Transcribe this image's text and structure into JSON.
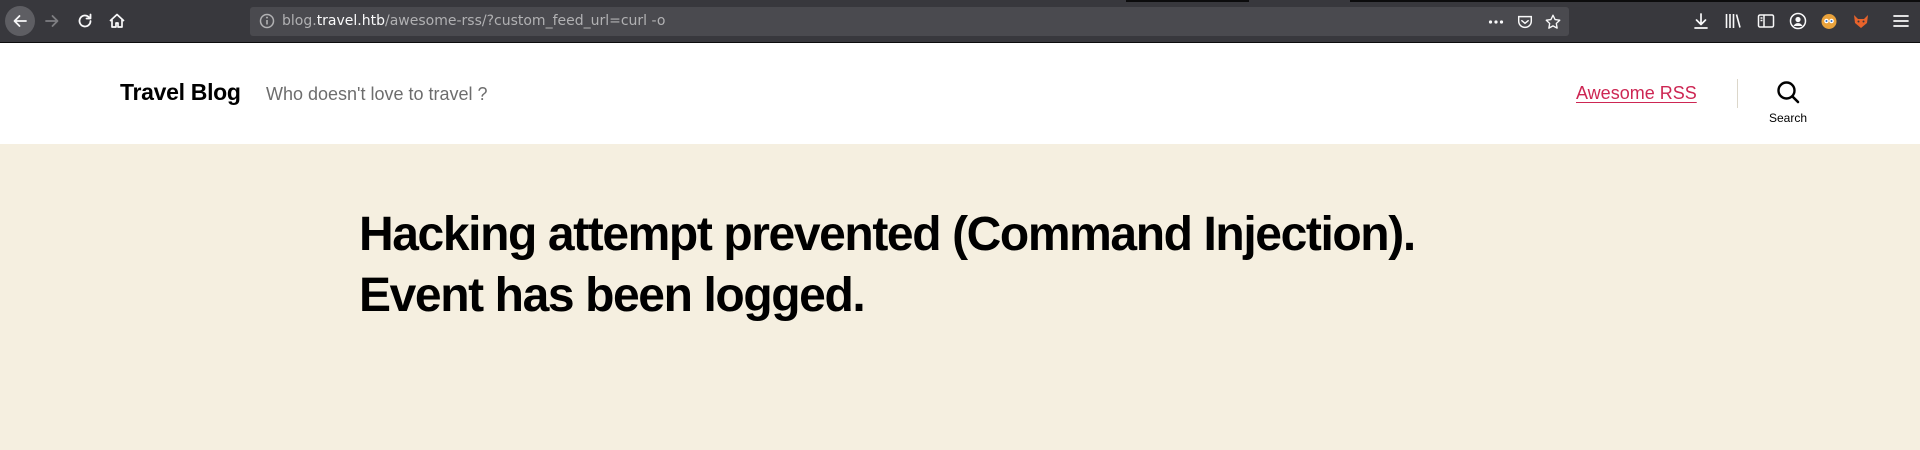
{
  "browser": {
    "url_host_prefix": "blog.",
    "url_host": "travel.htb",
    "url_path": "/awesome-rss/?custom_feed_url=curl -o",
    "icons": [
      "back-icon",
      "forward-icon",
      "reload-icon",
      "home-icon",
      "site-info-icon",
      "page-actions-icon",
      "pocket-icon",
      "bookmark-star-icon",
      "downloads-icon",
      "library-icon",
      "sidebar-icon",
      "account-icon",
      "extension-icon",
      "foxyproxy-icon",
      "menu-icon"
    ]
  },
  "site": {
    "title": "Travel Blog",
    "description": "Who doesn't love to travel ?",
    "nav_link": "Awesome RSS",
    "search_label": "Search",
    "accent_color": "#cd2653",
    "background_color": "#f5efe0"
  },
  "main": {
    "message_line1": "Hacking attempt prevented (Command Injection).",
    "message_line2": "Event has been logged."
  }
}
